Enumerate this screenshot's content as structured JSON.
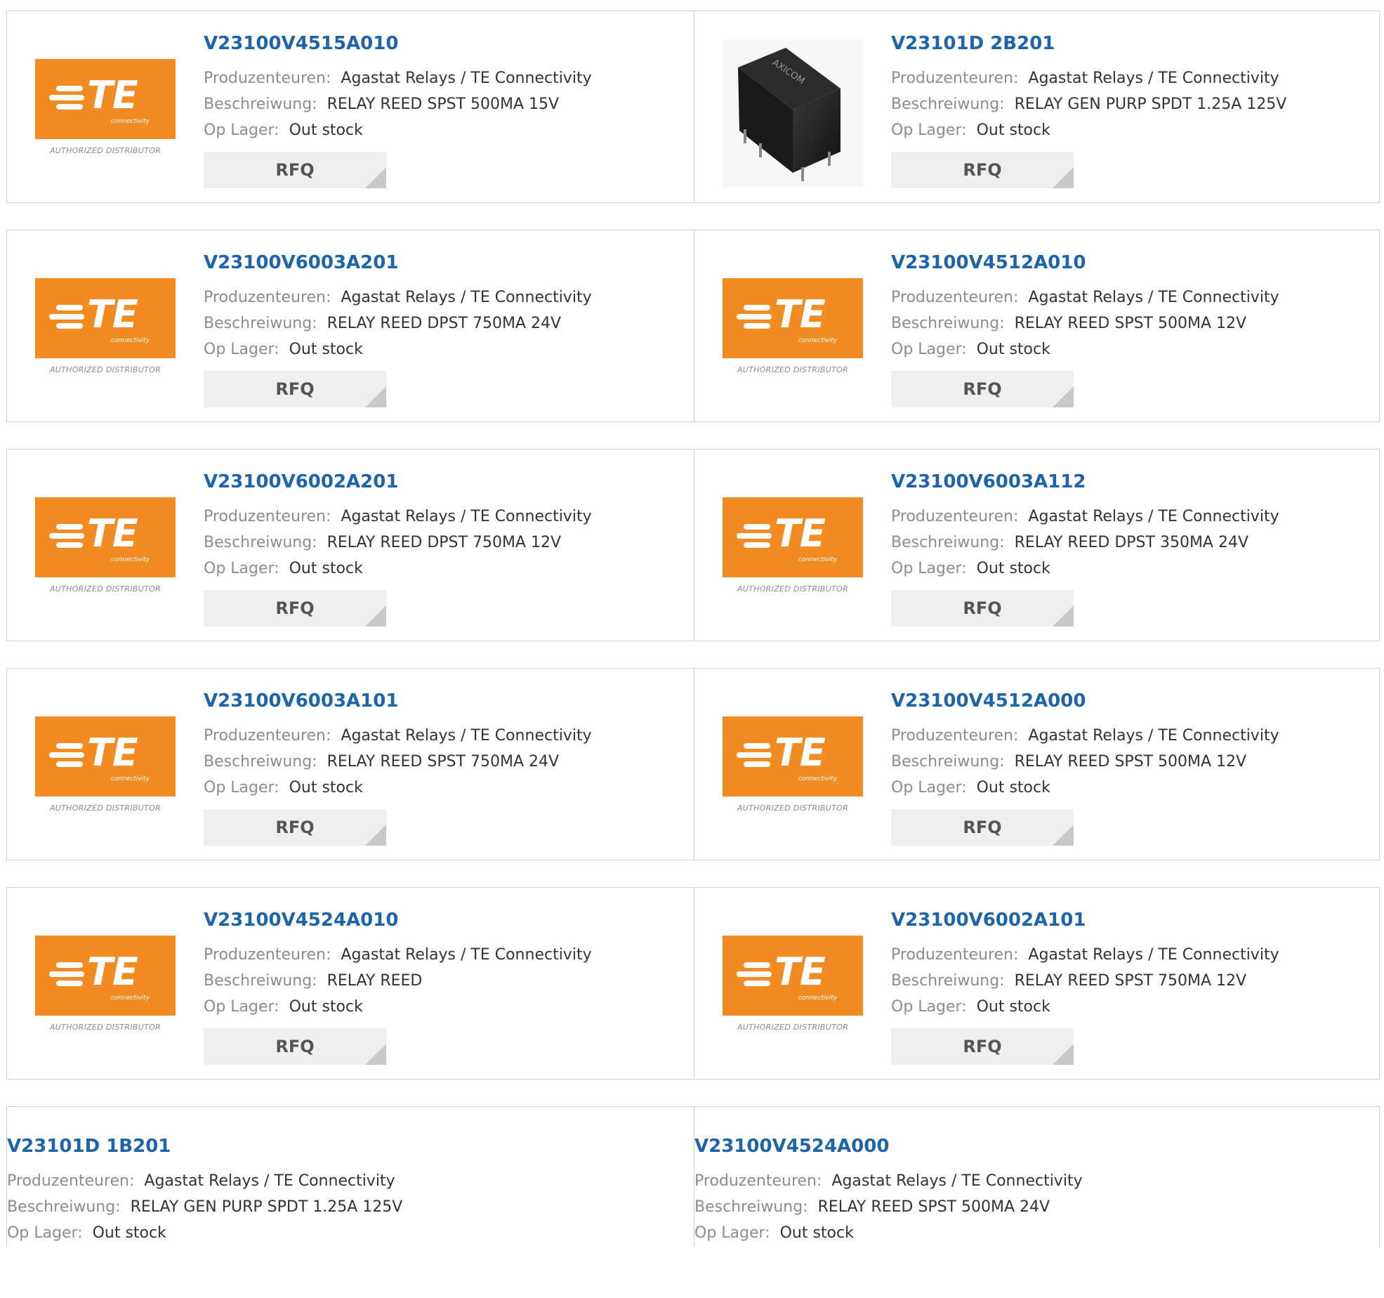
{
  "labels": {
    "manufacturer": "Produzenteuren:",
    "description": "Beschreiwung:",
    "stock": "Op Lager:",
    "rfq": "RFQ"
  },
  "logo": {
    "mark": "TE",
    "sub": "connectivity",
    "tagline": "AUTHORIZED DISTRIBUTOR"
  },
  "relay_image": {
    "brand_text": "AXICOM"
  },
  "colors": {
    "link": "#1e64aa",
    "te_orange": "#f28b22",
    "label_gray": "#8c8c8c",
    "rfq_bg": "#efefef"
  },
  "products": [
    {
      "part": "V23100V4515A010",
      "manufacturer": "Agastat Relays / TE Connectivity",
      "description": "RELAY REED SPST 500MA 15V",
      "stock": "Out stock",
      "image": "te-logo"
    },
    {
      "part": "V23101D 2B201",
      "manufacturer": "Agastat Relays / TE Connectivity",
      "description": "RELAY GEN PURP SPDT 1.25A 125V",
      "stock": "Out stock",
      "image": "relay-photo"
    },
    {
      "part": "V23100V6003A201",
      "manufacturer": "Agastat Relays / TE Connectivity",
      "description": "RELAY REED DPST 750MA 24V",
      "stock": "Out stock",
      "image": "te-logo"
    },
    {
      "part": "V23100V4512A010",
      "manufacturer": "Agastat Relays / TE Connectivity",
      "description": "RELAY REED SPST 500MA 12V",
      "stock": "Out stock",
      "image": "te-logo"
    },
    {
      "part": "V23100V6002A201",
      "manufacturer": "Agastat Relays / TE Connectivity",
      "description": "RELAY REED DPST 750MA 12V",
      "stock": "Out stock",
      "image": "te-logo"
    },
    {
      "part": "V23100V6003A112",
      "manufacturer": "Agastat Relays / TE Connectivity",
      "description": "RELAY REED DPST 350MA 24V",
      "stock": "Out stock",
      "image": "te-logo"
    },
    {
      "part": "V23100V6003A101",
      "manufacturer": "Agastat Relays / TE Connectivity",
      "description": "RELAY REED SPST 750MA 24V",
      "stock": "Out stock",
      "image": "te-logo"
    },
    {
      "part": "V23100V4512A000",
      "manufacturer": "Agastat Relays / TE Connectivity",
      "description": "RELAY REED SPST 500MA 12V",
      "stock": "Out stock",
      "image": "te-logo"
    },
    {
      "part": "V23100V4524A010",
      "manufacturer": "Agastat Relays / TE Connectivity",
      "description": "RELAY REED",
      "stock": "Out stock",
      "image": "te-logo"
    },
    {
      "part": "V23100V6002A101",
      "manufacturer": "Agastat Relays / TE Connectivity",
      "description": "RELAY REED SPST 750MA 12V",
      "stock": "Out stock",
      "image": "te-logo"
    },
    {
      "part": "V23101D 1B201",
      "manufacturer": "Agastat Relays / TE Connectivity",
      "description": "RELAY GEN PURP SPDT 1.25A 125V",
      "stock": "Out stock",
      "image": "none"
    },
    {
      "part": "V23100V4524A000",
      "manufacturer": "Agastat Relays / TE Connectivity",
      "description": "RELAY REED SPST 500MA 24V",
      "stock": "Out stock",
      "image": "none"
    }
  ]
}
